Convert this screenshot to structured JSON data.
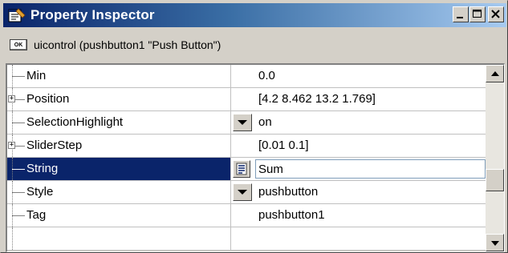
{
  "window": {
    "title": "Property Inspector",
    "colors": {
      "title_bar_start": "#0a246a",
      "title_bar_end": "#a6caf0",
      "selected_row": "#0a246a"
    }
  },
  "title_buttons": {
    "minimize_icon": "minimize-icon",
    "maximize_icon": "maximize-icon",
    "close_icon": "close-icon"
  },
  "object_bar": {
    "icon_text": "OK",
    "label": "uicontrol (pushbutton1 \"Push Button\")"
  },
  "properties": [
    {
      "name": "Min",
      "value": "0.0",
      "expandable": false,
      "control": "none"
    },
    {
      "name": "Position",
      "value": "[4.2 8.462 13.2 1.769]",
      "expandable": true,
      "control": "none"
    },
    {
      "name": "SelectionHighlight",
      "value": "on",
      "expandable": false,
      "control": "dropdown"
    },
    {
      "name": "SliderStep",
      "value": "[0.01 0.1]",
      "expandable": true,
      "control": "none"
    },
    {
      "name": "String",
      "value": "Sum",
      "expandable": false,
      "control": "edit",
      "selected": true
    },
    {
      "name": "Style",
      "value": "pushbutton",
      "expandable": false,
      "control": "dropdown"
    },
    {
      "name": "Tag",
      "value": "pushbutton1",
      "expandable": false,
      "control": "none"
    }
  ]
}
